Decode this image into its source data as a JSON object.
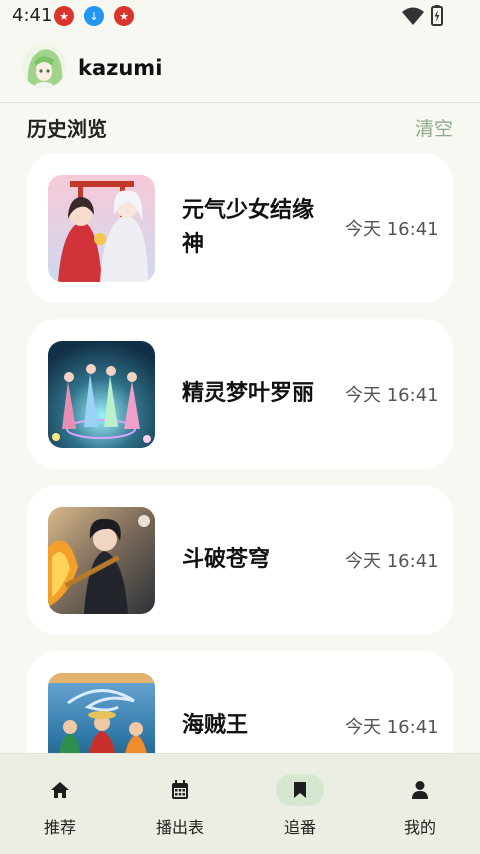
{
  "status_bar": {
    "time": "4:41"
  },
  "header": {
    "username": "kazumi"
  },
  "history": {
    "title": "历史浏览",
    "clear_label": "清空",
    "items": [
      {
        "title": "元气少女结缘神",
        "time": "今天 16:41"
      },
      {
        "title": "精灵梦叶罗丽",
        "time": "今天 16:41"
      },
      {
        "title": "斗破苍穹",
        "time": "今天 16:41"
      },
      {
        "title": "海贼王",
        "time": "今天 16:41"
      }
    ]
  },
  "bottom_nav": {
    "items": [
      {
        "label": "推荐",
        "icon": "home-icon"
      },
      {
        "label": "播出表",
        "icon": "calendar-icon"
      },
      {
        "label": "追番",
        "icon": "bookmark-icon",
        "active": true
      },
      {
        "label": "我的",
        "icon": "person-icon"
      }
    ]
  },
  "colors": {
    "background": "#f6f8f1",
    "card": "#ffffff",
    "accent_light": "#d5e8cf",
    "clear_text": "#8fa98a",
    "nav_bg": "#eaeee3"
  }
}
